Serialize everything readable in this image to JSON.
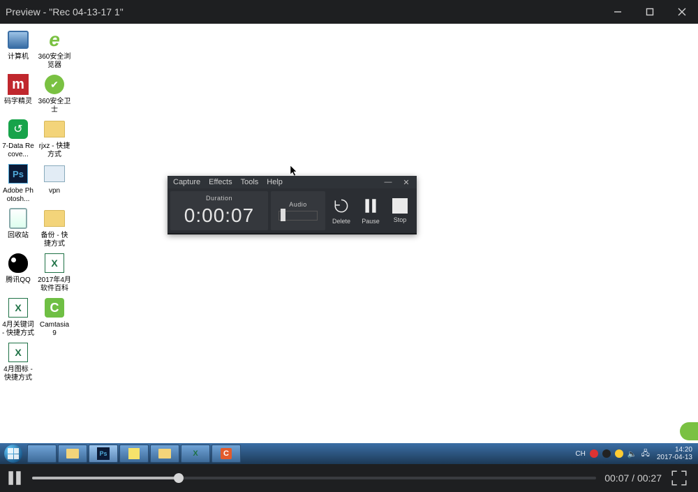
{
  "window": {
    "title": "Preview  -  \"Rec 04-13-17 1\""
  },
  "desktop": {
    "icons": [
      {
        "name": "computer",
        "label": "计算机",
        "glyph": "monitor"
      },
      {
        "name": "360-browser",
        "label": "360安全浏览器",
        "glyph": "e"
      },
      {
        "name": "mazijingl",
        "label": "码字精灵",
        "glyph": "m"
      },
      {
        "name": "360-guard",
        "label": "360安全卫士",
        "glyph": "shield"
      },
      {
        "name": "7data",
        "label": "7-Data Recove...",
        "glyph": "recover"
      },
      {
        "name": "rjxz",
        "label": "rjxz - 快捷方式",
        "glyph": "folder"
      },
      {
        "name": "photoshop",
        "label": "Adobe Photosh...",
        "glyph": "ps"
      },
      {
        "name": "vpn",
        "label": "vpn",
        "glyph": "vpn"
      },
      {
        "name": "recycle",
        "label": "回收站",
        "glyph": "bin"
      },
      {
        "name": "backup",
        "label": "备份 - 快捷方式",
        "glyph": "folder"
      },
      {
        "name": "qq",
        "label": "腾讯QQ",
        "glyph": "qq"
      },
      {
        "name": "apr-encyc",
        "label": "2017年4月软件百科",
        "glyph": "excel"
      },
      {
        "name": "apr-keywords",
        "label": "4月关键词 - 快捷方式",
        "glyph": "excel"
      },
      {
        "name": "camtasia",
        "label": "Camtasia 9",
        "glyph": "cam"
      },
      {
        "name": "apr-icons",
        "label": "4月图标 - 快捷方式",
        "glyph": "excel"
      }
    ]
  },
  "recorder": {
    "menu": {
      "capture": "Capture",
      "effects": "Effects",
      "tools": "Tools",
      "help": "Help"
    },
    "duration_label": "Duration",
    "duration_value": "0:00:07",
    "audio_label": "Audio",
    "buttons": {
      "delete": "Delete",
      "pause": "Pause",
      "stop": "Stop"
    }
  },
  "taskbar": {
    "ime": "CH",
    "clock_time": "14:20",
    "clock_date": "2017-04-13"
  },
  "playback": {
    "current": "00:07",
    "total": "00:27",
    "separator": " / ",
    "progress_pct": 26
  }
}
